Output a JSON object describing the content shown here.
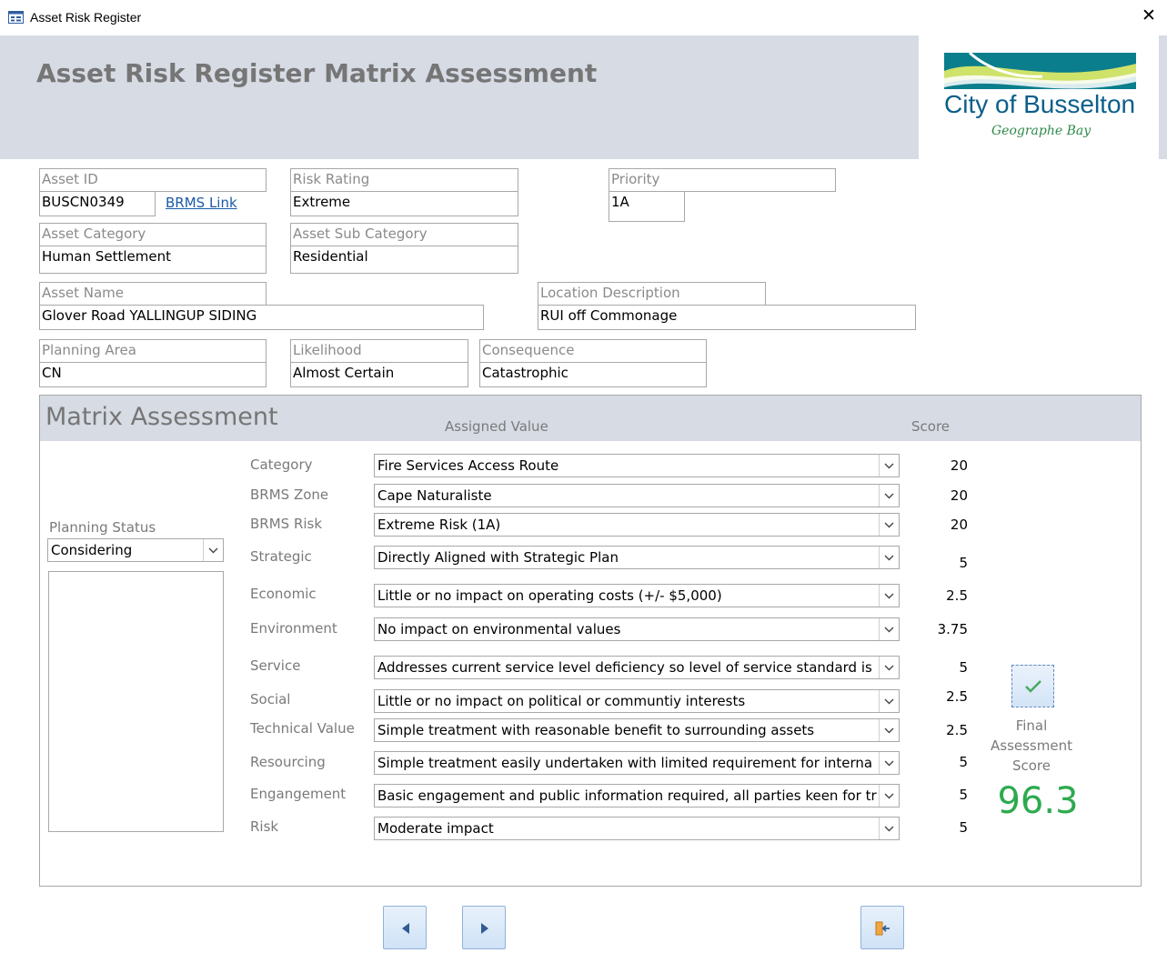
{
  "window": {
    "title": "Asset Risk Register"
  },
  "header": {
    "title": "Asset Risk Register Matrix Assessment",
    "logo_text": "City of Busselton",
    "logo_tagline": "Geographe Bay"
  },
  "fields": {
    "asset_id": {
      "label": "Asset ID",
      "value": "BUSCN0349",
      "link": "BRMS Link"
    },
    "risk_rating": {
      "label": "Risk Rating",
      "value": "Extreme"
    },
    "priority": {
      "label": "Priority",
      "value": "1A"
    },
    "asset_category": {
      "label": "Asset Category",
      "value": "Human Settlement"
    },
    "asset_sub_category": {
      "label": "Asset Sub Category",
      "value": "Residential"
    },
    "asset_name": {
      "label": "Asset Name",
      "value": "Glover Road YALLINGUP SIDING"
    },
    "location_description": {
      "label": "Location Description",
      "value": "RUI off Commonage"
    },
    "planning_area": {
      "label": "Planning Area",
      "value": "CN"
    },
    "likelihood": {
      "label": "Likelihood",
      "value": "Almost Certain"
    },
    "consequence": {
      "label": "Consequence",
      "value": "Catastrophic"
    }
  },
  "matrix": {
    "title": "Matrix Assessment",
    "assigned_value_header": "Assigned Value",
    "score_header": "Score",
    "planning_status": {
      "label": "Planning Status",
      "value": "Considering"
    },
    "rows": [
      {
        "label": "Category",
        "value": "Fire Services Access Route",
        "score": "20"
      },
      {
        "label": "BRMS Zone",
        "value": "Cape Naturaliste",
        "score": "20"
      },
      {
        "label": "BRMS Risk",
        "value": "Extreme Risk (1A)",
        "score": "20"
      },
      {
        "label": "Strategic",
        "value": "Directly Aligned with Strategic Plan",
        "score": "5"
      },
      {
        "label": "Economic",
        "value": "Little or no impact on operating costs (+/- $5,000)",
        "score": "2.5"
      },
      {
        "label": "Environment",
        "value": "No impact on environmental values",
        "score": "3.75"
      },
      {
        "label": "Service",
        "value": "Addresses current service level deficiency so level of service standard is a",
        "score": "5"
      },
      {
        "label": "Social",
        "value": "Little or no impact on political or communtiy interests",
        "score": "2.5"
      },
      {
        "label": "Technical Value",
        "value": "Simple treatment with reasonable benefit to surrounding assets",
        "score": "2.5"
      },
      {
        "label": "Resourcing",
        "value": "Simple treatment easily undertaken with limited requirement for interna",
        "score": "5"
      },
      {
        "label": "Engangement",
        "value": "Basic engagement and public information required, all parties keen for tre",
        "score": "5"
      },
      {
        "label": "Risk",
        "value": "Moderate impact",
        "score": "5"
      }
    ],
    "final_label": "Final Assessment Score",
    "final_label_lines": [
      "Final",
      "Assessment",
      "Score"
    ],
    "final_score": "96.3"
  },
  "colors": {
    "header_bg": "#d6dbe4",
    "score_green": "#2daa4f",
    "link_blue": "#1a5aa8"
  },
  "icons": {
    "prev": "triangle-left-icon",
    "next": "triangle-right-icon",
    "exit": "exit-door-icon",
    "confirm": "checkmark-icon"
  }
}
